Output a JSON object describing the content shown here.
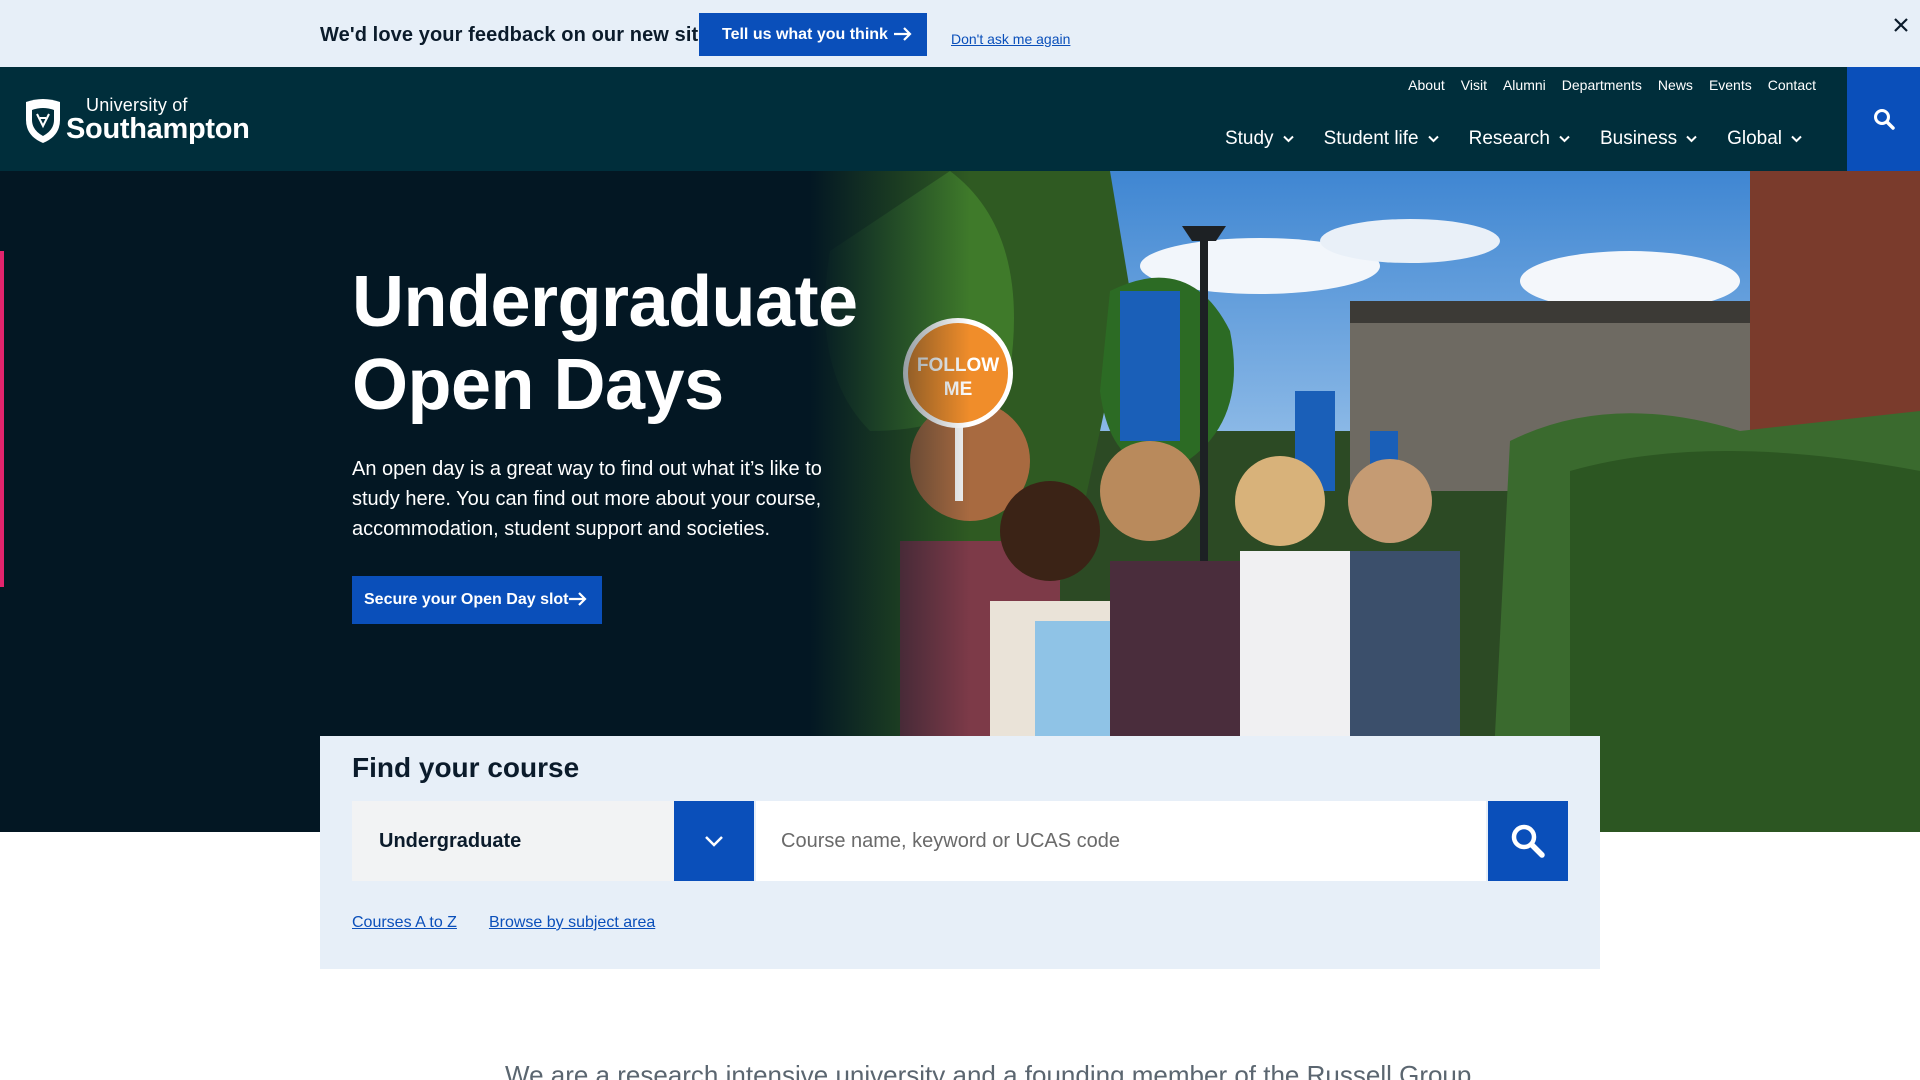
{
  "feedback": {
    "message": "We'd love your feedback on our new site",
    "button_label": "Tell us what you think",
    "dismiss_label": "Don't ask me again"
  },
  "header": {
    "logo_line1": "University of",
    "logo_line2": "Southampton",
    "utility_links": [
      "About",
      "Visit",
      "Alumni",
      "Departments",
      "News",
      "Events",
      "Contact"
    ],
    "main_nav": [
      "Study",
      "Student life",
      "Research",
      "Business",
      "Global"
    ]
  },
  "hero": {
    "title_line1": "Undergraduate",
    "title_line2": "Open Days",
    "intro": "An open day is a great way to find out what it’s like to study here. You can find out more about your course, accommodation, student support and societies.",
    "cta_label": "Secure your Open Day slot",
    "sign_line1": "FOLLOW",
    "sign_line2": "ME"
  },
  "find_course": {
    "heading": "Find your course",
    "level_selected": "Undergraduate",
    "search_placeholder": "Course name, keyword or UCAS code",
    "links": [
      "Courses A to Z",
      "Browse by subject area"
    ]
  },
  "research_text": "We are a research intensive university and a founding member of the Russell Group",
  "colors": {
    "brand_blue": "#0a4fba",
    "header_teal": "#002e3b",
    "accent_pink": "#e2246d",
    "banner_bg": "#e7eff8"
  }
}
